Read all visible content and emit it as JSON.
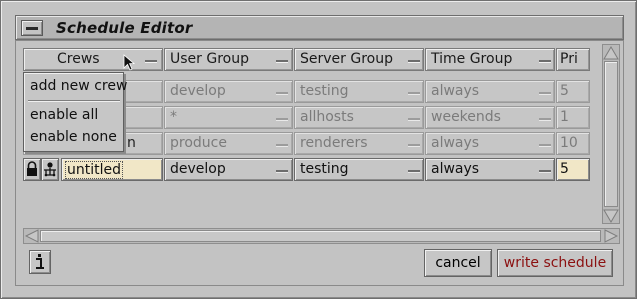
{
  "window": {
    "title": "Schedule Editor"
  },
  "columns": [
    {
      "label": "Crews"
    },
    {
      "label": "User Group"
    },
    {
      "label": "Server Group"
    },
    {
      "label": "Time Group"
    },
    {
      "label": "Pri"
    }
  ],
  "rows": [
    {
      "crew": "",
      "user_group": "develop",
      "server_group": "testing",
      "time_group": "always",
      "pri": "5"
    },
    {
      "crew": "",
      "user_group": "*",
      "server_group": "allhosts",
      "time_group": "weekends",
      "pri": "1"
    },
    {
      "crew": "n",
      "user_group": "produce",
      "server_group": "renderers",
      "time_group": "always",
      "pri": "10"
    },
    {
      "crew": "untitled",
      "user_group": "develop",
      "server_group": "testing",
      "time_group": "always",
      "pri": "5"
    }
  ],
  "crew_menu": {
    "items": [
      "add new crew",
      "enable all",
      "enable none"
    ]
  },
  "buttons": {
    "cancel": "cancel",
    "write": "write schedule"
  },
  "icons": [
    "window-menu-icon",
    "lock-icon",
    "crew-icon",
    "info-icon",
    "chevron-up-icon",
    "chevron-down-icon",
    "chevron-left-icon",
    "chevron-right-icon",
    "mouse-pointer-icon"
  ],
  "colors": {
    "edit_field_bg": "#f1e7c7",
    "write_button_text": "#8b1010",
    "dimmed_text": "#7b7b7b"
  }
}
